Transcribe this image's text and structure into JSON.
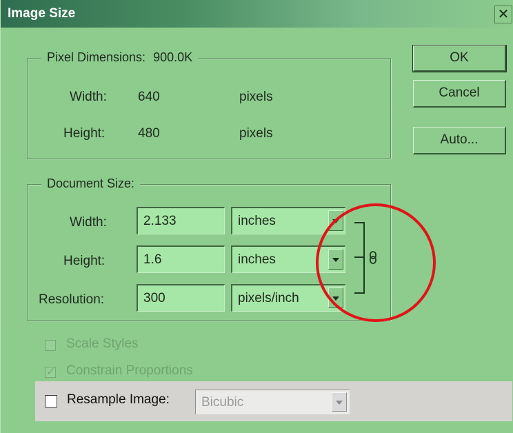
{
  "dialog": {
    "title": "Image Size",
    "close_glyph": "✕"
  },
  "pixel_dimensions": {
    "legend": "Pixel Dimensions:",
    "size": "900.0K",
    "width_label": "Width:",
    "width_value": "640",
    "width_unit": "pixels",
    "height_label": "Height:",
    "height_value": "480",
    "height_unit": "pixels"
  },
  "document_size": {
    "legend": "Document Size:",
    "width_label": "Width:",
    "width_value": "2.133",
    "width_unit": "inches",
    "height_label": "Height:",
    "height_value": "1.6",
    "height_unit": "inches",
    "resolution_label": "Resolution:",
    "resolution_value": "300",
    "resolution_unit": "pixels/inch",
    "link_icon": "chain-link-icon"
  },
  "buttons": {
    "ok": "OK",
    "cancel": "Cancel",
    "auto": "Auto..."
  },
  "options": {
    "scale_styles": {
      "label": "Scale Styles",
      "checked": false,
      "enabled": false
    },
    "constrain_proportions": {
      "label": "Constrain Proportions",
      "checked": true,
      "enabled": false
    },
    "resample": {
      "label": "Resample Image:",
      "checked": false,
      "method": "Bicubic"
    }
  },
  "colors": {
    "dialog_bg": "#8dcc8d",
    "field_bg": "#a6e6a6",
    "annotation_circle": "#e0141a"
  }
}
